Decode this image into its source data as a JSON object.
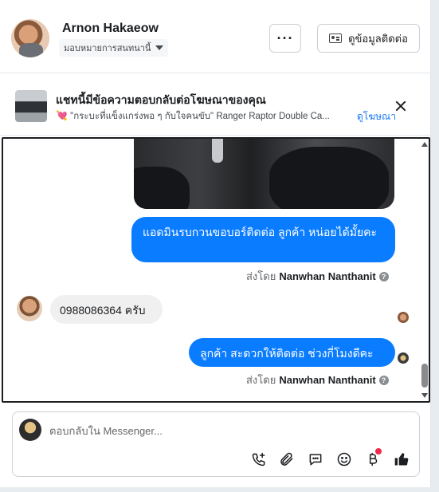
{
  "header": {
    "name": "Arnon Hakaeow",
    "assign_label": "มอบหมายการสนทนานี้",
    "more_label": "···",
    "contact_label": "ดูข้อมูลติดต่อ"
  },
  "ad": {
    "title": "แชทนี้มีข้อความตอบกลับต่อโฆษณาของคุณ",
    "subtitle": "\"กระบะที่แข็งแกร่งพอ ๆ กับใจคนขับ\" Ranger Raptor Double Ca...",
    "link_label": "ดูโฆษณา"
  },
  "messages": {
    "out1": "แอดมินรบกวนขอบอร์ติดต่อ ลูกค้า หน่อยได้มั้ยคะ",
    "sent_by_prefix": "ส่งโดย",
    "sent_by_name": "Nanwhan Nanthanit",
    "in1": "0988086364 ครับ",
    "out2": "ลูกค้า สะดวกให้ติดต่อ ช่วงกี่โมงดีคะ"
  },
  "composer": {
    "placeholder": "ตอบกลับใน Messenger..."
  },
  "colors": {
    "accent": "#0a7cff",
    "link": "#1877f2",
    "incoming_bubble": "#f0f0f0"
  }
}
